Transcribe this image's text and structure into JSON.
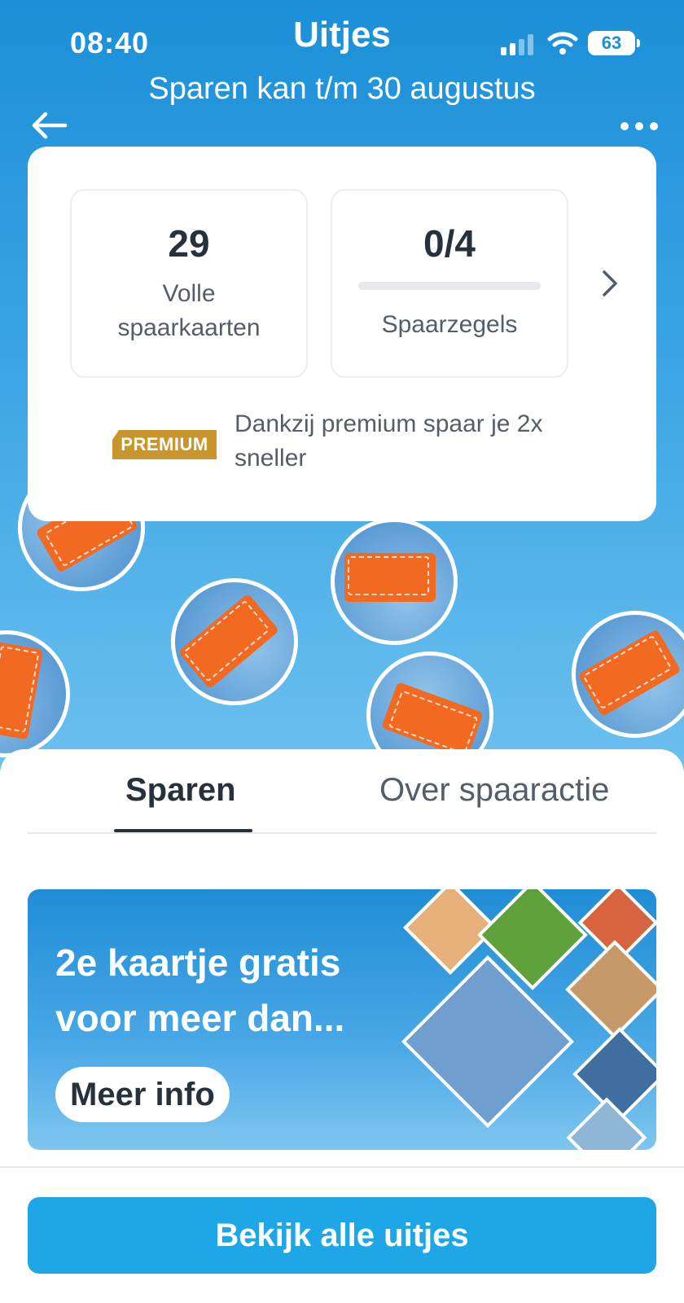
{
  "status_bar": {
    "time": "08:40",
    "battery": "63"
  },
  "header": {
    "title": "Uitjes",
    "subtitle": "Sparen kan t/m 30 augustus",
    "back_icon": "arrow-left-icon",
    "more_icon": "more-horizontal-icon"
  },
  "summary": {
    "full_cards": {
      "value": "29",
      "label": "Volle spaarkaarten"
    },
    "stamps": {
      "value": "0/4",
      "label": "Spaarzegels",
      "progress": 0
    },
    "chevron_icon": "chevron-right-icon",
    "premium_badge": "PREMIUM",
    "premium_text": "Dankzij premium spaar je 2x sneller"
  },
  "tabs": [
    {
      "label": "Sparen",
      "active": true
    },
    {
      "label": "Over spaaractie",
      "active": false
    }
  ],
  "banner": {
    "title": "2e kaartje gratis voor meer dan...",
    "button": "Meer info"
  },
  "cta": {
    "label": "Bekijk alle uitjes"
  },
  "colors": {
    "hero_blue": "#1b8fd8",
    "cta_blue": "#1fa6e6",
    "premium_gold": "#c8962c",
    "stamp_orange": "#f26a21"
  }
}
